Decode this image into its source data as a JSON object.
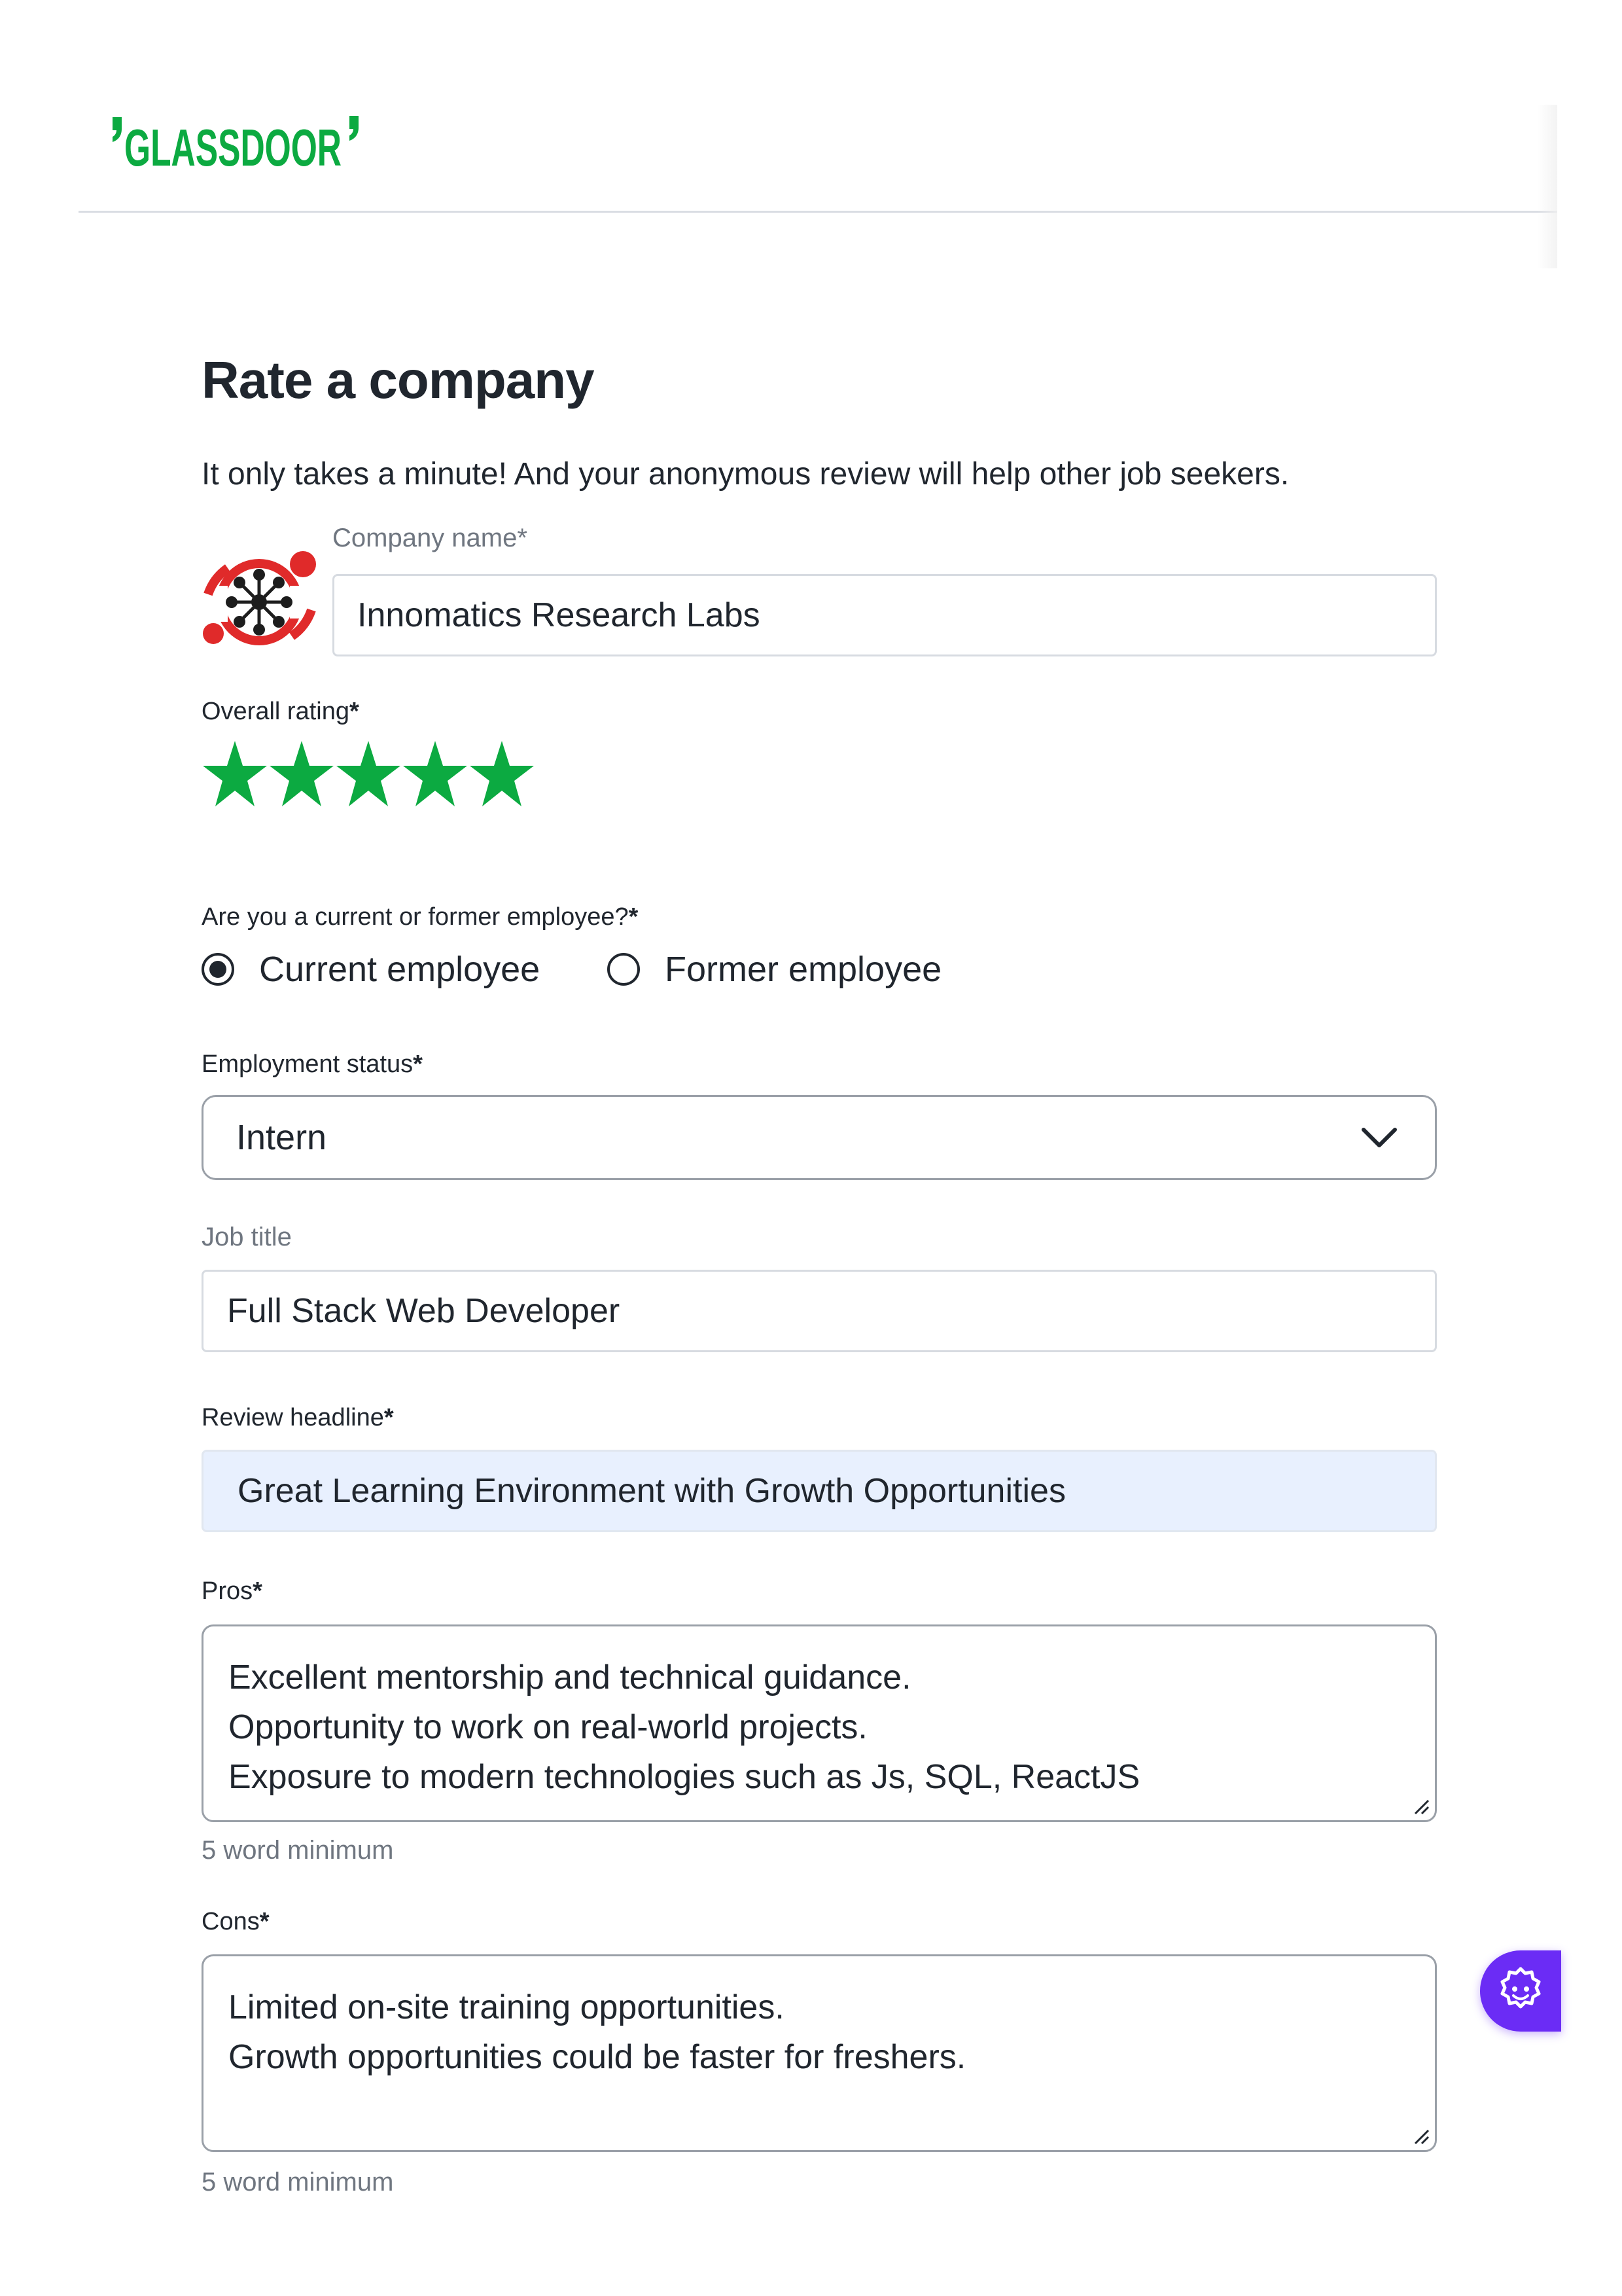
{
  "header": {
    "logo_text": "GLASSDOOR",
    "brand_color": "#0caa41"
  },
  "page": {
    "title": "Rate a company",
    "subtitle": "It only takes a minute! And your anonymous review will help other job seekers."
  },
  "company": {
    "label": "Company name*",
    "value": "Innomatics Research Labs",
    "logo_icon": "innomatics-logo"
  },
  "rating": {
    "label": "Overall rating",
    "required_mark": "*",
    "value": 5,
    "max": 5,
    "star_color": "#0caa41"
  },
  "employee_status": {
    "label": "Are you a current or former employee?",
    "required_mark": "*",
    "options": [
      {
        "label": "Current employee",
        "selected": true
      },
      {
        "label": "Former employee",
        "selected": false
      }
    ]
  },
  "employment_status": {
    "label": "Employment status",
    "required_mark": "*",
    "value": "Intern",
    "icon": "chevron-down-icon"
  },
  "job_title": {
    "label": "Job title",
    "value": "Full Stack Web Developer"
  },
  "headline": {
    "label": "Review headline",
    "required_mark": "*",
    "value": "Great Learning Environment with Growth Opportunities",
    "autofill_bg": "#e8f0fe"
  },
  "pros": {
    "label": "Pros",
    "required_mark": "*",
    "lines": [
      "Excellent mentorship and technical guidance.",
      "Opportunity to work on real-world projects.",
      "Exposure to modern technologies such as Js, SQL, ReactJS"
    ],
    "hint": "5 word minimum"
  },
  "cons": {
    "label": "Cons",
    "required_mark": "*",
    "lines": [
      "Limited on-site training opportunities.",
      "Growth opportunities could be faster for freshers."
    ],
    "hint": "5 word minimum"
  },
  "assistant": {
    "icon": "bot-icon",
    "color": "#6b2cf5"
  }
}
